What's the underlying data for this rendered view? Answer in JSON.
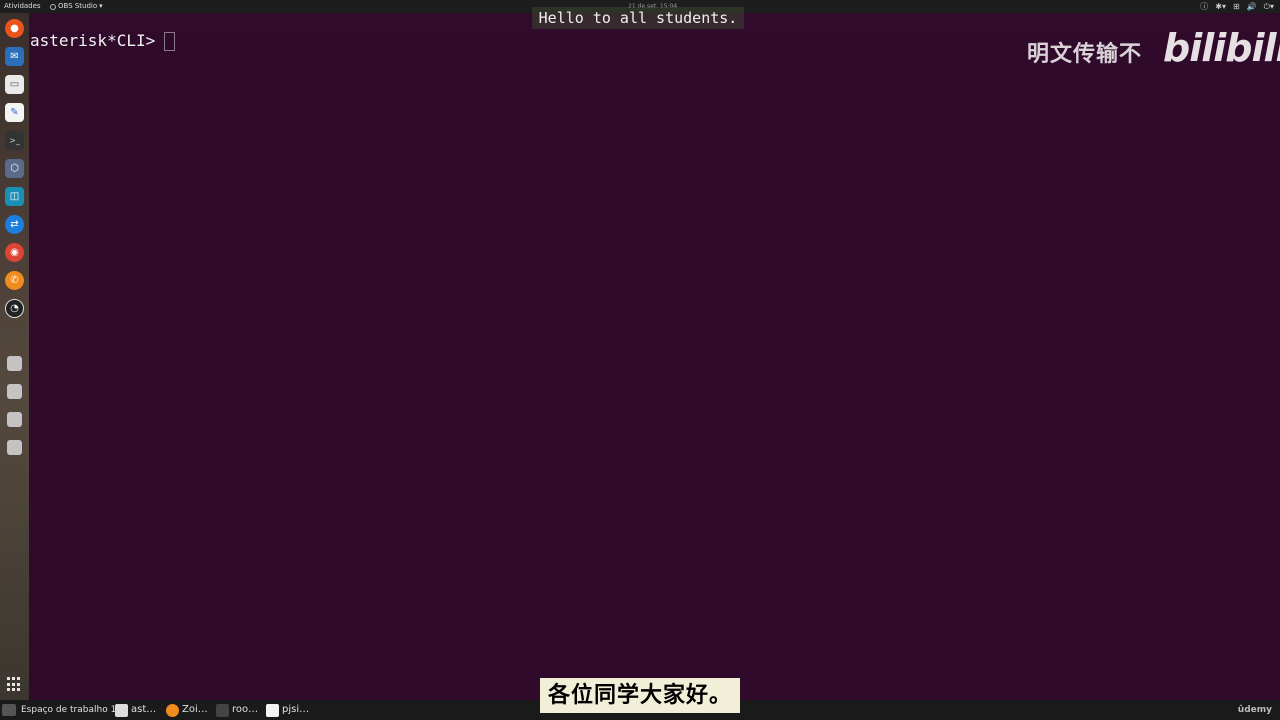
{
  "topbar": {
    "activities": "Atividades",
    "app_name": "OBS Studio",
    "clock": "21 de set. 15:04"
  },
  "terminal": {
    "prompt": "asterisk*CLI>"
  },
  "subtitles": {
    "english": "Hello to all students.",
    "chinese": "各位同学大家好。"
  },
  "watermark": {
    "chinese_text": "明文传输不",
    "logo_text": "bilibili"
  },
  "taskbar": {
    "workspace": "Espaço de trabalho 1",
    "tasks": [
      {
        "label": "ast…",
        "icon": "folder-icon"
      },
      {
        "label": "Zoi…",
        "icon": "zoiper-icon"
      },
      {
        "label": "roo…",
        "icon": "terminal-icon"
      },
      {
        "label": "pjsi…",
        "icon": "text-editor-icon"
      }
    ],
    "brand": "ûdemy"
  },
  "colors": {
    "terminal_bg": "#300a2a",
    "topbar_bg": "#1d1d1d",
    "taskbar_bg": "#1a1a1a"
  }
}
